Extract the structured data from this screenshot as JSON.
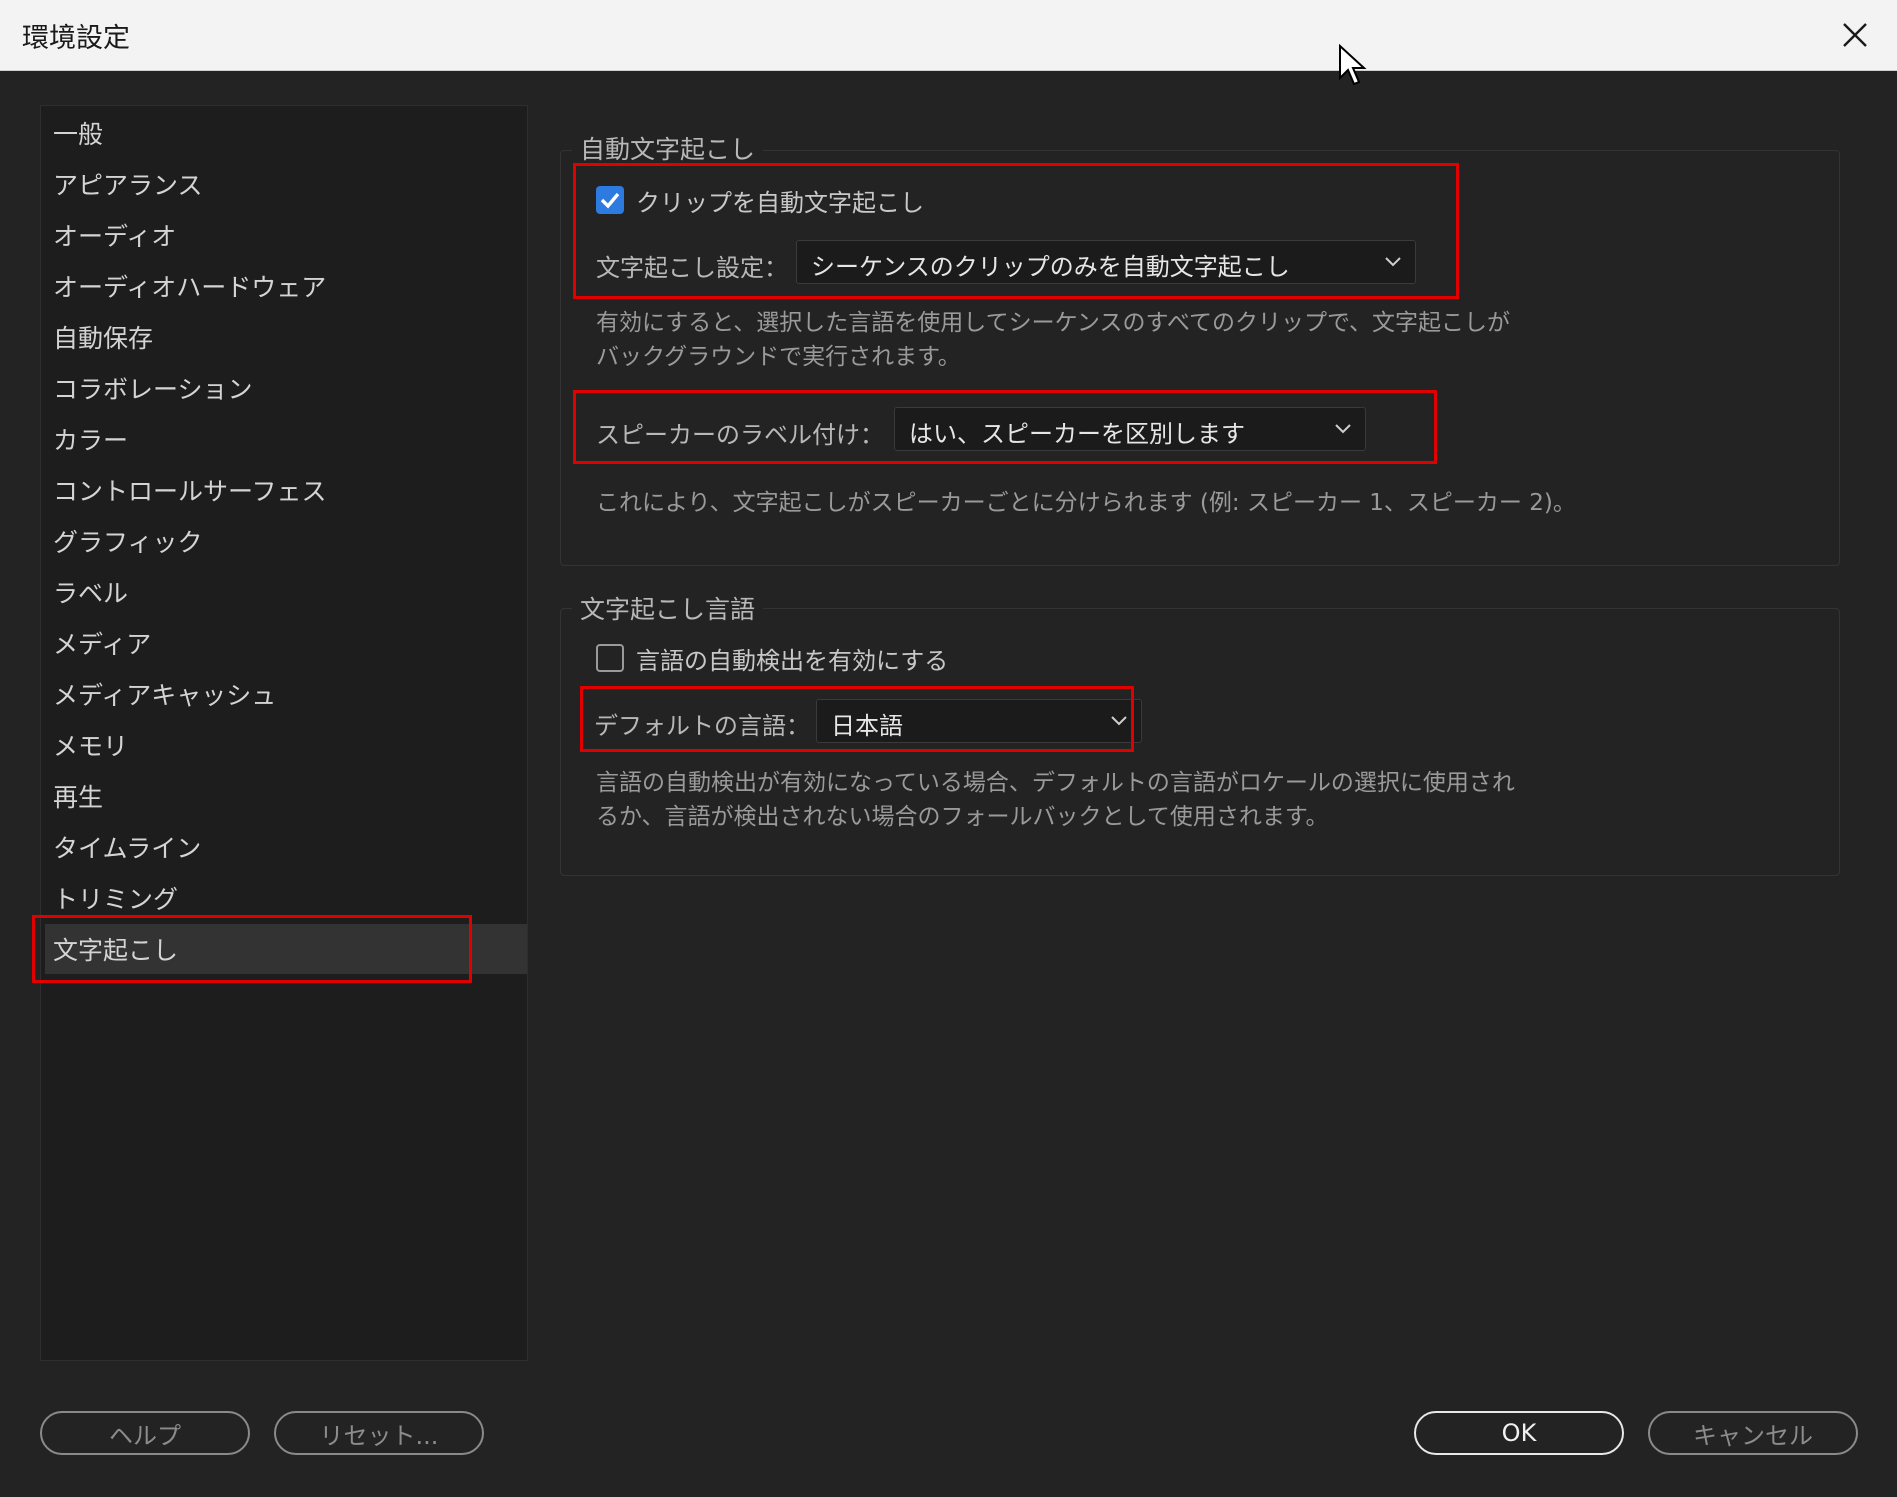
{
  "window": {
    "title": "環境設定"
  },
  "sidebar": {
    "items": [
      "一般",
      "アピアランス",
      "オーディオ",
      "オーディオハードウェア",
      "自動保存",
      "コラボレーション",
      "カラー",
      "コントロールサーフェス",
      "グラフィック",
      "ラベル",
      "メディア",
      "メディアキャッシュ",
      "メモリ",
      "再生",
      "タイムライン",
      "トリミング",
      "文字起こし"
    ],
    "selected": "文字起こし"
  },
  "auto_transcribe": {
    "group_title": "自動文字起こし",
    "checkbox_label": "クリップを自動文字起こし",
    "checkbox_checked": true,
    "setting_label": "文字起こし設定：",
    "setting_value": "シーケンスのクリップのみを自動文字起こし",
    "desc_line1": "有効にすると、選択した言語を使用してシーケンスのすべてのクリップで、文字起こしが",
    "desc_line2": "バックグラウンドで実行されます。",
    "speaker_label": "スピーカーのラベル付け：",
    "speaker_value": "はい、スピーカーを区別します",
    "speaker_desc": "これにより、文字起こしがスピーカーごとに分けられます (例: スピーカー 1、スピーカー 2)。"
  },
  "language": {
    "group_title": "文字起こし言語",
    "checkbox_label": "言語の自動検出を有効にする",
    "checkbox_checked": false,
    "default_label": "デフォルトの言語：",
    "default_value": "日本語",
    "desc_line1": "言語の自動検出が有効になっている場合、デフォルトの言語がロケールの選択に使用され",
    "desc_line2": "るか、言語が検出されない場合のフォールバックとして使用されます。"
  },
  "buttons": {
    "help": "ヘルプ",
    "reset": "リセット...",
    "ok": "OK",
    "cancel": "キャンセル"
  },
  "colors": {
    "highlight": "#e00000",
    "checkbox_on": "#2d7ae0"
  }
}
